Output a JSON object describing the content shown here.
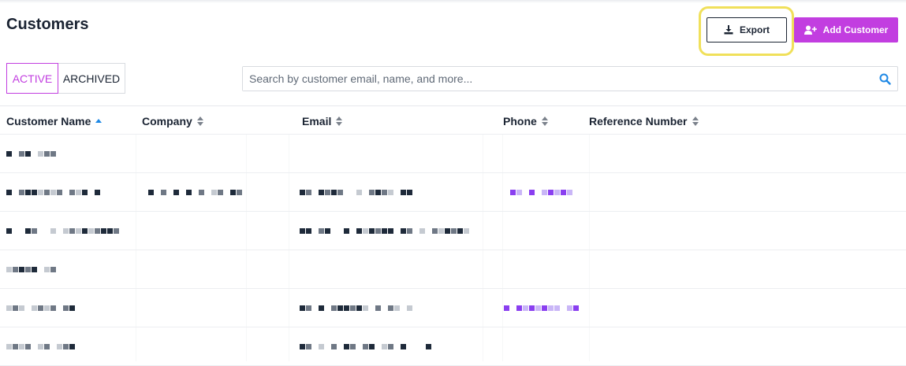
{
  "page": {
    "title": "Customers"
  },
  "toolbar": {
    "export_label": "Export",
    "add_label": "Add Customer"
  },
  "tabs": [
    {
      "label": "ACTIVE",
      "active": true
    },
    {
      "label": "ARCHIVED",
      "active": false
    }
  ],
  "search": {
    "placeholder": "Search by customer email, name, and more...",
    "value": ""
  },
  "table": {
    "columns": [
      {
        "label": "Customer Name",
        "sort": "ascending"
      },
      {
        "label": "Company",
        "sort": "none"
      },
      {
        "label": "Email",
        "sort": "none"
      },
      {
        "label": "Phone",
        "sort": "none"
      },
      {
        "label": "Reference Number",
        "sort": "none"
      }
    ],
    "rows_note_visible_count": 6
  },
  "colors": {
    "accent": "#c23ee0",
    "text": "#1b2433",
    "highlight": "#f0e05a",
    "search_icon": "#1e88e5",
    "phone_redacted": "#8a3ff0"
  },
  "icons": {
    "export": "download-icon",
    "add": "add-user-icon",
    "search": "search-icon",
    "sort_asc": "sort-ascending-icon",
    "sort": "sort-icon"
  }
}
